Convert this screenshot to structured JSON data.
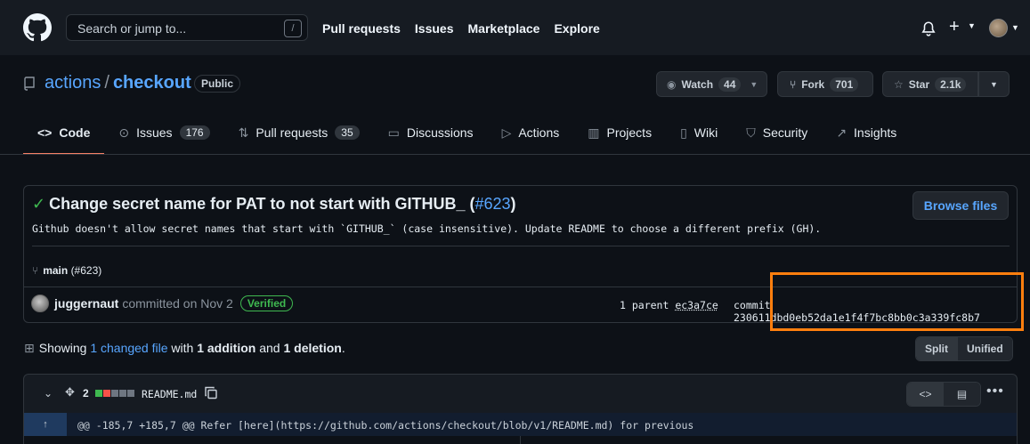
{
  "header": {
    "search_placeholder": "Search or jump to...",
    "search_shortcut": "/",
    "nav": [
      "Pull requests",
      "Issues",
      "Marketplace",
      "Explore"
    ],
    "plus_label": "+"
  },
  "repo": {
    "owner": "actions",
    "separator": "/",
    "name": "checkout",
    "visibility": "Public",
    "watch_label": "Watch",
    "watch_count": "44",
    "fork_label": "Fork",
    "fork_count": "701",
    "star_label": "Star",
    "star_count": "2.1k"
  },
  "tabs": [
    {
      "label": "Code",
      "icon": "code-icon",
      "count": ""
    },
    {
      "label": "Issues",
      "icon": "issue-icon",
      "count": "176"
    },
    {
      "label": "Pull requests",
      "icon": "pull-request-icon",
      "count": "35"
    },
    {
      "label": "Discussions",
      "icon": "discussion-icon",
      "count": ""
    },
    {
      "label": "Actions",
      "icon": "play-icon",
      "count": ""
    },
    {
      "label": "Projects",
      "icon": "project-icon",
      "count": ""
    },
    {
      "label": "Wiki",
      "icon": "book-icon",
      "count": ""
    },
    {
      "label": "Security",
      "icon": "shield-icon",
      "count": ""
    },
    {
      "label": "Insights",
      "icon": "graph-icon",
      "count": ""
    }
  ],
  "commit": {
    "title": "Change secret name for PAT to not start with GITHUB_ (",
    "pr_link": "#623",
    "title_end": ")",
    "browse_label": "Browse files",
    "description": "Github doesn't allow secret names that start with `GITHUB_` (case insensitive). Update README to choose a different prefix (GH).",
    "branch": "main",
    "branch_pr": "(#623)",
    "author": "juggernaut",
    "committed_text": "committed on Nov 2",
    "verified_label": "Verified",
    "parent_label": "1 parent",
    "parent_sha": "ec3a7ce",
    "commit_label": "commit",
    "sha": "230611dbd0eb52da1e1f4f7bc8bb0c3a339fc8b7"
  },
  "summary": {
    "prefix": "Showing",
    "changed_files": "1 changed file",
    "with": "with",
    "additions": "1 addition",
    "and": "and",
    "deletions": "1 deletion",
    "end": ".",
    "split_label": "Split",
    "unified_label": "Unified"
  },
  "file": {
    "diff_count": "2",
    "name": "README.md",
    "hunk_expand": "↑",
    "hunk": "@@ -185,7 +185,7 @@ Refer [here](https://github.com/actions/checkout/blob/v1/README.md) for previous",
    "more_label": "•••"
  },
  "colors": {
    "accent_link": "#58a6ff",
    "success": "#3fb950",
    "danger": "#f85149",
    "tab_underline": "#f78166",
    "highlight_box": "#ff7f0e"
  }
}
